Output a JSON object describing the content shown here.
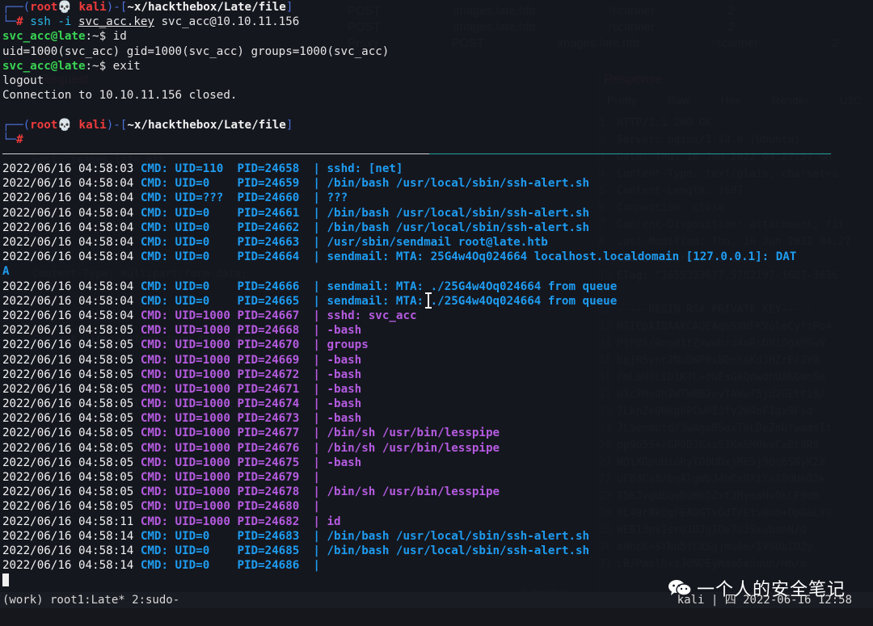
{
  "ghost": {
    "req_rows": [
      [
        "POST",
        "images.late.htb",
        "/scanner",
        "2"
      ],
      [
        "POST",
        "images.late.htb",
        "/scanner",
        "2"
      ],
      [
        "Proxy",
        "POST",
        "images.late.htb",
        "/scanner",
        "2"
      ]
    ],
    "request_title": "Request",
    "response_title": "Response",
    "response_tabs": [
      "Pretty",
      "Raw",
      "Hex",
      "Render",
      "U2C"
    ],
    "response_lines": [
      {
        "n": "1",
        "t": "HTTP/1.1 200 OK"
      },
      {
        "n": "2",
        "t": "Server: nginx/1.14.0 (Ubuntu)"
      },
      {
        "n": "3",
        "t": "Date: Thu, 16 Jun 2022 04:27:57 GM"
      },
      {
        "n": "4",
        "t": "Content-Type: text/plain; charset=u"
      },
      {
        "n": "5",
        "t": "Content-Length: 1687"
      },
      {
        "n": "6",
        "t": "Connection: close"
      },
      {
        "n": "7",
        "t": "Content-Disposition: attachment; fil"
      },
      {
        "n": "8",
        "t": "Last-Modified: Thu, 16 Jun 2022 04:27"
      },
      {
        "n": "9",
        "t": "Cache-Control: no-cache"
      },
      {
        "n": "10",
        "t": "ETag: \"1655353677.5782197-1687-3636"
      },
      {
        "n": "11",
        "t": ""
      },
      {
        "n": "12",
        "t": "-----BEGIN RSA PRIVATE KEY-----"
      },
      {
        "n": "13",
        "t": "MIIEpAIBAAKCAQEAqe5XWFKVqleCyfzPo4"
      },
      {
        "n": "14",
        "t": "PtP8S/0nqd1tZxwwhrd4mRsDNiOgaMSwV"
      },
      {
        "n": "15",
        "t": "bgjRSynr2NuDWP0xBDmhsKdJHZrEr2V8"
      },
      {
        "n": "16",
        "t": "/mLaH6LID1KTL+dUFsGkQnwdhUAK6Wn5e"
      },
      {
        "n": "17",
        "t": "d1c7MsOh2WTWRB2ovTAWwf5jd2GEttiS/"
      },
      {
        "n": "18",
        "t": "7LkhZeQHkgkPCwHIJfy2W4oF1gx9Fsd"
      },
      {
        "n": "19",
        "t": "JLSenmptq/3wAgoBSqxTaLDeZnUfwamsIt"
      },
      {
        "n": "20",
        "t": "pp9o5S+/GP9D3KasS1Km5M0kxCaBt9R9"
      },
      {
        "n": "21",
        "t": "WOlXDpuHioRyTO8UDxjME5j9Qq6SNyK2X"
      },
      {
        "n": "22",
        "t": "uFB4Cz8/bgAlgWbJ4hCn9XiYn18QUeQ3k"
      },
      {
        "n": "23",
        "t": "T5KJvqUbqeDuMsOZxtJMymaHvOkLF9d6"
      },
      {
        "n": "24",
        "t": "0L49rBkOgFEAOGTv6dT/Etv4uo+OpRaLYO"
      },
      {
        "n": "25",
        "t": "WEB13pvIsrU1UJgIOe7cJSxwbanN/Q"
      },
      {
        "n": "26",
        "t": "aHhcK+SYNn5fCXSgjmu6e/1VSUbZD2y"
      },
      {
        "n": "27",
        "t": "LB/Paol0+zJdNDEyNam5e5nUh/Ho/m"
      }
    ],
    "left_lines": [
      "Host: images.late.htb",
      "Content-Type: multipart/form-data;",
      "Content-Disposition: form-data; name=",
      "Content-Type: multipart/form-data;",
      "filename=\"test.png\""
    ],
    "matches": "0 matches"
  },
  "terminal": {
    "prompt_prefix": "┌──(",
    "prompt_user": "root💀 kali",
    "prompt_mid": ")-[",
    "prompt_path": "~x/hackthebox/Late/file",
    "prompt_end": "]",
    "prompt_second": "└─",
    "prompt_hash": "#",
    "ssh_cmd_1": "ssh -i ",
    "ssh_key": "svc_acc.key",
    "ssh_cmd_2": " svc_acc@10.10.11.156",
    "remote_prompt": "svc_acc@late",
    "remote_suffix": ":~$",
    "cmd_id": " id",
    "id_output": "uid=1000(svc_acc) gid=1000(svc_acc) groups=1000(svc_acc)",
    "cmd_exit": " exit",
    "logout": "logout",
    "closed": "Connection to 10.10.11.156 closed.",
    "pspy": [
      {
        "ts": "2022/06/16 04:58:03",
        "uid": "CMD: UID=110 ",
        "pid": "PID=24658",
        "cmd": "sshd: [net]",
        "u": "sys"
      },
      {
        "ts": "2022/06/16 04:58:04",
        "uid": "CMD: UID=0   ",
        "pid": "PID=24659",
        "cmd": "/bin/bash /usr/local/sbin/ssh-alert.sh",
        "u": "sys"
      },
      {
        "ts": "2022/06/16 04:58:04",
        "uid": "CMD: UID=??? ",
        "pid": "PID=24660",
        "cmd": "???",
        "u": "sys"
      },
      {
        "ts": "2022/06/16 04:58:04",
        "uid": "CMD: UID=0   ",
        "pid": "PID=24661",
        "cmd": "/bin/bash /usr/local/sbin/ssh-alert.sh",
        "u": "sys"
      },
      {
        "ts": "2022/06/16 04:58:04",
        "uid": "CMD: UID=0   ",
        "pid": "PID=24662",
        "cmd": "/bin/bash /usr/local/sbin/ssh-alert.sh",
        "u": "sys"
      },
      {
        "ts": "2022/06/16 04:58:04",
        "uid": "CMD: UID=0   ",
        "pid": "PID=24663",
        "cmd": "/usr/sbin/sendmail root@late.htb",
        "u": "sys"
      },
      {
        "ts": "2022/06/16 04:58:04",
        "uid": "CMD: UID=0   ",
        "pid": "PID=24664",
        "cmd": "sendmail: MTA: 25G4w4Oq024664 localhost.localdomain [127.0.0.1]: DAT",
        "u": "sys"
      },
      {
        "wrap": "A"
      },
      {
        "ts": "2022/06/16 04:58:04",
        "uid": "CMD: UID=0   ",
        "pid": "PID=24666",
        "cmd": "sendmail: MTA: ./25G4w4Oq024664 from queue",
        "u": "sys"
      },
      {
        "ts": "2022/06/16 04:58:04",
        "uid": "CMD: UID=0   ",
        "pid": "PID=24665",
        "cmd": "sendmail: MTA: ./25G4w4Oq024664 from queue",
        "u": "sys"
      },
      {
        "ts": "2022/06/16 04:58:04",
        "uid": "CMD: UID=1000",
        "pid": "PID=24667",
        "cmd": "sshd: svc_acc",
        "u": "usr"
      },
      {
        "ts": "2022/06/16 04:58:05",
        "uid": "CMD: UID=1000",
        "pid": "PID=24668",
        "cmd": "-bash",
        "u": "usr"
      },
      {
        "ts": "2022/06/16 04:58:05",
        "uid": "CMD: UID=1000",
        "pid": "PID=24670",
        "cmd": "groups",
        "u": "usr"
      },
      {
        "ts": "2022/06/16 04:58:05",
        "uid": "CMD: UID=1000",
        "pid": "PID=24669",
        "cmd": "-bash",
        "u": "usr"
      },
      {
        "ts": "2022/06/16 04:58:05",
        "uid": "CMD: UID=1000",
        "pid": "PID=24672",
        "cmd": "-bash",
        "u": "usr"
      },
      {
        "ts": "2022/06/16 04:58:05",
        "uid": "CMD: UID=1000",
        "pid": "PID=24671",
        "cmd": "-bash",
        "u": "usr"
      },
      {
        "ts": "2022/06/16 04:58:05",
        "uid": "CMD: UID=1000",
        "pid": "PID=24674",
        "cmd": "-bash",
        "u": "usr"
      },
      {
        "ts": "2022/06/16 04:58:05",
        "uid": "CMD: UID=1000",
        "pid": "PID=24673",
        "cmd": "-bash",
        "u": "usr"
      },
      {
        "ts": "2022/06/16 04:58:05",
        "uid": "CMD: UID=1000",
        "pid": "PID=24677",
        "cmd": "/bin/sh /usr/bin/lesspipe",
        "u": "usr"
      },
      {
        "ts": "2022/06/16 04:58:05",
        "uid": "CMD: UID=1000",
        "pid": "PID=24676",
        "cmd": "/bin/sh /usr/bin/lesspipe",
        "u": "usr"
      },
      {
        "ts": "2022/06/16 04:58:05",
        "uid": "CMD: UID=1000",
        "pid": "PID=24675",
        "cmd": "-bash",
        "u": "usr"
      },
      {
        "ts": "2022/06/16 04:58:05",
        "uid": "CMD: UID=1000",
        "pid": "PID=24679",
        "cmd": "",
        "u": "usr"
      },
      {
        "ts": "2022/06/16 04:58:05",
        "uid": "CMD: UID=1000",
        "pid": "PID=24678",
        "cmd": "/bin/sh /usr/bin/lesspipe",
        "u": "usr"
      },
      {
        "ts": "2022/06/16 04:58:05",
        "uid": "CMD: UID=1000",
        "pid": "PID=24680",
        "cmd": "",
        "u": "usr"
      },
      {
        "ts": "2022/06/16 04:58:11",
        "uid": "CMD: UID=1000",
        "pid": "PID=24682",
        "cmd": "id",
        "u": "usr"
      },
      {
        "ts": "2022/06/16 04:58:14",
        "uid": "CMD: UID=0   ",
        "pid": "PID=24683",
        "cmd": "/bin/bash /usr/local/sbin/ssh-alert.sh",
        "u": "sys"
      },
      {
        "ts": "2022/06/16 04:58:14",
        "uid": "CMD: UID=0   ",
        "pid": "PID=24685",
        "cmd": "/bin/bash /usr/local/sbin/ssh-alert.sh",
        "u": "sys"
      },
      {
        "ts": "2022/06/16 04:58:14",
        "uid": "CMD: UID=0   ",
        "pid": "PID=24686",
        "cmd": "",
        "u": "sys"
      }
    ]
  },
  "status": {
    "left": "(work) root1:Late* 2:sudo-",
    "right": "kali | 四  2022-06-16 12:58"
  },
  "watermark": {
    "text": "一个人的安全笔记",
    "icon": "wechat-icon"
  }
}
